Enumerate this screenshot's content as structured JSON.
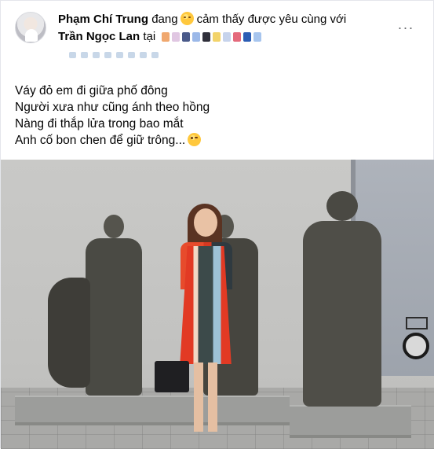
{
  "post": {
    "author": "Phạm Chí Trung",
    "status_verb": "đang",
    "feeling": "cảm thấy được yêu",
    "with_word": "cùng với",
    "tagged": "Trần Ngọc Lan",
    "location_prefix": "tại",
    "more_icon": "···",
    "caption_lines": [
      "Váy đỏ em đi giữa phố đông",
      "Người xưa như cũng ánh theo hồng",
      "Nàng đi thắp lửa trong bao mắt",
      "Anh cố bon chen để giữ trông..."
    ]
  },
  "icons": {
    "avatar": "avatar",
    "feeling": "smiling-face-with-hearts-icon",
    "caption_end": "winking-face-icon",
    "more": "more-horizontal-icon"
  },
  "colors": {
    "text": "#050505",
    "muted": "#65676b",
    "border": "#e4e6eb"
  }
}
